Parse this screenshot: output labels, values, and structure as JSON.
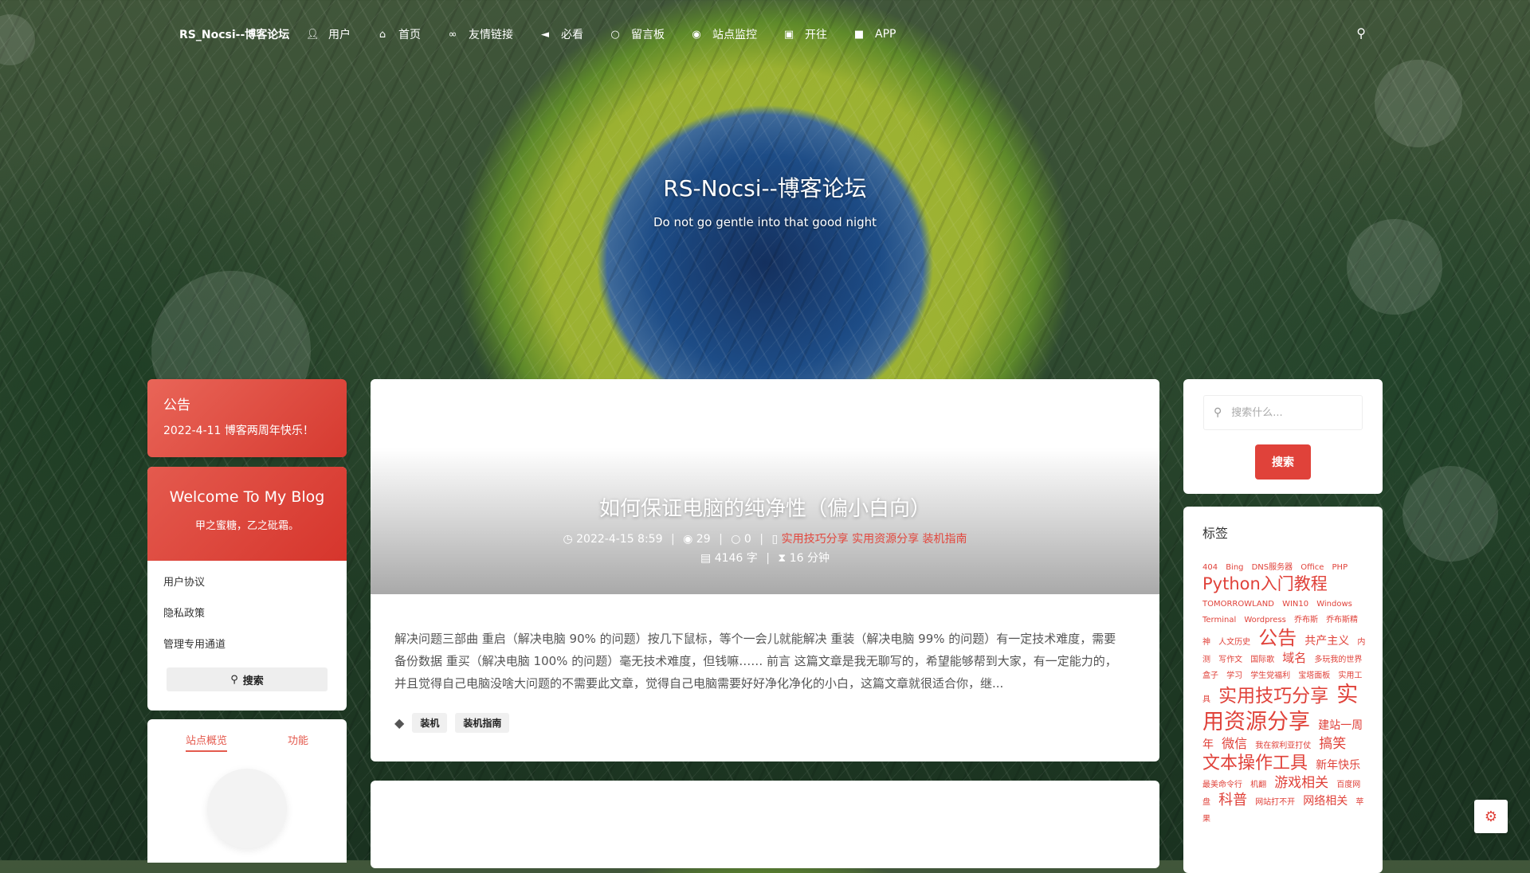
{
  "site": {
    "brand": "RS_Nocsi--博客论坛",
    "hero_title": "RS-Nocsi--博客论坛",
    "hero_subtitle": "Do not go gentle into that good night"
  },
  "nav": [
    {
      "label": "用户",
      "icon": "user-icon"
    },
    {
      "label": "首页",
      "icon": "home-icon"
    },
    {
      "label": "友情链接",
      "icon": "link-icon"
    },
    {
      "label": "必看",
      "icon": "megaphone-icon"
    },
    {
      "label": "留言板",
      "icon": "comment-icon"
    },
    {
      "label": "站点监控",
      "icon": "eye-icon"
    },
    {
      "label": "开往",
      "icon": "train-icon"
    },
    {
      "label": "APP",
      "icon": "briefcase-icon"
    }
  ],
  "notice": {
    "title": "公告",
    "content": "2022-4-11 博客两周年快乐！"
  },
  "welcome": {
    "heading": "Welcome To My Blog",
    "subtitle": "甲之蜜糖，乙之砒霜。",
    "links": [
      "用户协议",
      "隐私政策",
      "管理专用通道"
    ],
    "search_label": "搜索"
  },
  "overview": {
    "tabs": [
      "站点概览",
      "功能"
    ]
  },
  "post": {
    "title": "如何保证电脑的纯净性（偏小白向）",
    "date": "2022-4-15 8:59",
    "views": "29",
    "comments": "0",
    "categories": [
      "实用技巧分享",
      "实用资源分享",
      "装机指南"
    ],
    "words": "4146 字",
    "read_time": "16 分钟",
    "excerpt": "解决问题三部曲 重启（解决电脑 90% 的问题）按几下鼠标，等个一会儿就能解决 重装（解决电脑 99% 的问题）有一定技术难度，需要备份数据 重买（解决电脑 100% 的问题）毫无技术难度，但钱嘛…… 前言 这篇文章是我无聊写的，希望能够帮到大家，有一定能力的，并且觉得自己电脑没啥大问题的不需要此文章，觉得自己电脑需要好好净化净化的小白，这篇文章就很适合你，继...",
    "tags": [
      "装机",
      "装机指南"
    ]
  },
  "sidebar_search": {
    "placeholder": "搜索什么...",
    "button": "搜索"
  },
  "tag_cloud": {
    "title": "标签",
    "tags": [
      {
        "text": "404",
        "size": 10
      },
      {
        "text": "Bing",
        "size": 10
      },
      {
        "text": "DNS服务器",
        "size": 10
      },
      {
        "text": "Office",
        "size": 10
      },
      {
        "text": "PHP",
        "size": 10
      },
      {
        "text": "Python入门教程",
        "size": 21
      },
      {
        "text": "TOMORROWLAND",
        "size": 10
      },
      {
        "text": "WIN10",
        "size": 10
      },
      {
        "text": "Windows",
        "size": 10
      },
      {
        "text": "Terminal",
        "size": 10
      },
      {
        "text": "Wordpress",
        "size": 10
      },
      {
        "text": "乔布斯",
        "size": 10
      },
      {
        "text": "乔布斯精神",
        "size": 10
      },
      {
        "text": "人文历史",
        "size": 10
      },
      {
        "text": "公告",
        "size": 24
      },
      {
        "text": "共产主义",
        "size": 14
      },
      {
        "text": "内测",
        "size": 10
      },
      {
        "text": "写作文",
        "size": 10
      },
      {
        "text": "国际歌",
        "size": 10
      },
      {
        "text": "域名",
        "size": 15
      },
      {
        "text": "多玩我的世界盒子",
        "size": 10
      },
      {
        "text": "学习",
        "size": 10
      },
      {
        "text": "学生党福利",
        "size": 10
      },
      {
        "text": "宝塔面板",
        "size": 10
      },
      {
        "text": "实用工具",
        "size": 10
      },
      {
        "text": "实用技巧分享",
        "size": 23
      },
      {
        "text": "实用资源分享",
        "size": 27
      },
      {
        "text": "建站一周年",
        "size": 14
      },
      {
        "text": "微信",
        "size": 16
      },
      {
        "text": "我在叙利亚打仗",
        "size": 10
      },
      {
        "text": "搞笑",
        "size": 17
      },
      {
        "text": "文本操作工具",
        "size": 22
      },
      {
        "text": "新年快乐",
        "size": 14
      },
      {
        "text": "最美命令行",
        "size": 10
      },
      {
        "text": "机翻",
        "size": 10
      },
      {
        "text": "游戏相关",
        "size": 17
      },
      {
        "text": "百度网盘",
        "size": 10
      },
      {
        "text": "科普",
        "size": 18
      },
      {
        "text": "网站打不开",
        "size": 10
      },
      {
        "text": "网络相关",
        "size": 14
      },
      {
        "text": "苹果",
        "size": 10
      }
    ]
  },
  "colors": {
    "accent": "#e0423a",
    "accent_gradient_start": "#e96558"
  }
}
